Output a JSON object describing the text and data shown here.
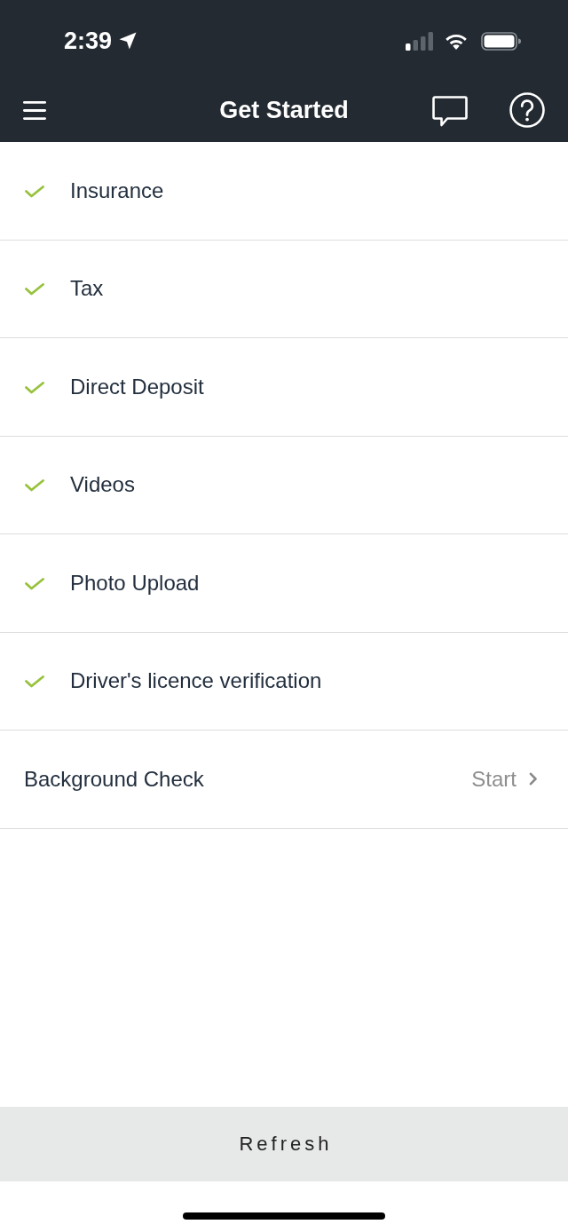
{
  "status_bar": {
    "time": "2:39"
  },
  "nav_bar": {
    "title": "Get Started"
  },
  "tasks": [
    {
      "label": "Insurance",
      "completed": true
    },
    {
      "label": "Tax",
      "completed": true
    },
    {
      "label": "Direct Deposit",
      "completed": true
    },
    {
      "label": "Videos",
      "completed": true
    },
    {
      "label": "Photo Upload",
      "completed": true
    },
    {
      "label": "Driver's licence verification",
      "completed": true
    },
    {
      "label": "Background Check",
      "completed": false,
      "action": "Start"
    }
  ],
  "refresh_button": {
    "label": "Refresh"
  }
}
